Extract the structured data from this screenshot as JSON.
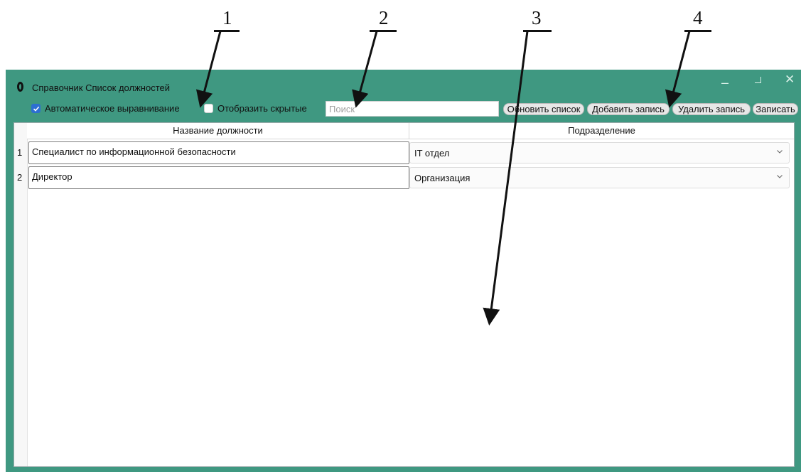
{
  "callouts": [
    "1",
    "2",
    "3",
    "4"
  ],
  "window": {
    "title": "Справочник Список должностей",
    "minimize_glyph": "–",
    "close_glyph": "✕"
  },
  "toolbar": {
    "auto_align_label": "Автоматическое выравнивание",
    "auto_align_checked": true,
    "show_hidden_label": "Отобразить скрытые",
    "show_hidden_checked": false,
    "search_placeholder": "Поиск",
    "search_value": "",
    "refresh_label": "Обновить список",
    "add_label": "Добавить запись",
    "delete_label": "Удалить запись",
    "save_label": "Записать"
  },
  "table": {
    "columns": [
      "Название должности",
      "Подразделение"
    ],
    "rows": [
      {
        "num": "1",
        "name": "Специалист по информационной безопасности",
        "department": "IT отдел"
      },
      {
        "num": "2",
        "name": "Директор",
        "department": "Организация"
      }
    ]
  },
  "colors": {
    "window_frame": "#3f9881",
    "checkbox_accent": "#2d6fd1"
  },
  "icons": [
    "window-icon",
    "minimize-icon",
    "maximize-icon",
    "close-icon",
    "checkmark-icon",
    "chevron-down-icon"
  ]
}
